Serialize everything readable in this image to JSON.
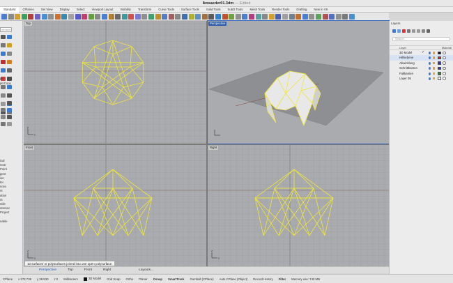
{
  "window": {
    "title": "Ikosaeder01.3dm",
    "edited": "— Edited"
  },
  "tabs": [
    "Standard",
    "CPlanes",
    "Set View",
    "Display",
    "Select",
    "Viewport Layout",
    "Visibility",
    "Transform",
    "Curve Tools",
    "Surface Tools",
    "Solid Tools",
    "SubD Tools",
    "Mesh Tools",
    "Render Tools",
    "Drafting",
    "New in V8"
  ],
  "command": {
    "placeholder": "mmand"
  },
  "left_panel": {
    "label1": "pin",
    "label2": "pinCopy",
    "list": [
      "ical",
      "near",
      "Point",
      "gent",
      "ion",
      "ter",
      "nora",
      "nt",
      "ation",
      "nt",
      "ntile",
      "ntersec",
      "Project",
      "",
      "nable"
    ]
  },
  "viewports": {
    "top": "Top",
    "perspective": "Perspective",
    "front": "Front",
    "right": "Right"
  },
  "axes": {
    "x": "x",
    "y": "y",
    "z": "z"
  },
  "layers": {
    "title": "Layers",
    "search_placeholder": "Search",
    "col_layer": "Layer",
    "col_material": "Material",
    "rows": [
      {
        "name": "3D Model",
        "current": "✓",
        "color": "#111111"
      },
      {
        "name": "Hilfsebene",
        "current": "",
        "color": "#d21f1f"
      },
      {
        "name": "Abwicklung",
        "current": "",
        "color": "#2a2ad6"
      },
      {
        "name": "Schnittkanten",
        "current": "",
        "color": "#2a2ad6"
      },
      {
        "name": "Faltkanten",
        "current": "",
        "color": "#1f8f1f"
      },
      {
        "name": "Layer 05",
        "current": "",
        "color": "#ffffff"
      }
    ]
  },
  "bottom_tabs": [
    "Perspective",
    "Top",
    "Front",
    "Right",
    "Layouts..."
  ],
  "tooltip": "10 surfaces or polysurfaces joined into one open polysurface.",
  "status": {
    "cplane": "CPlane",
    "x": "x 272.738",
    "y": "y 38.530",
    "z": "z 0",
    "units": "Millimeters",
    "layer": "3D Model",
    "items": [
      "Grid Snap",
      "Ortho",
      "Planar",
      "Osnap",
      "SmartTrack",
      "Gumball (CPlane)",
      "Auto CPlane (Object)",
      "Record History",
      "Filter",
      "Memory use: 740 MB"
    ]
  },
  "colors": {
    "wire": "#f0e63a",
    "viewport_bg": "#a9abae",
    "active_border": "#2f5ea8"
  }
}
